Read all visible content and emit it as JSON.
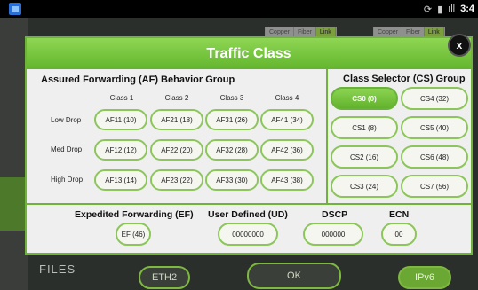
{
  "statusbar": {
    "time": "3:4"
  },
  "background": {
    "files_label": "FILES",
    "mini_tabs_left": [
      "Copper",
      "Fiber",
      "Link"
    ],
    "mini_tabs_right": [
      "Copper",
      "Fiber",
      "Link"
    ],
    "eth2_label": "ETH2",
    "ok_label": "OK",
    "ipv6_label": "IPv6"
  },
  "dialog": {
    "title": "Traffic Class",
    "close_label": "x",
    "af": {
      "title": "Assured Forwarding (AF) Behavior Group",
      "columns": [
        "Class 1",
        "Class 2",
        "Class 3",
        "Class 4"
      ],
      "rows": [
        {
          "label": "Low Drop",
          "values": [
            "AF11 (10)",
            "AF21 (18)",
            "AF31 (26)",
            "AF41 (34)"
          ]
        },
        {
          "label": "Med Drop",
          "values": [
            "AF12 (12)",
            "AF22 (20)",
            "AF32 (28)",
            "AF42 (36)"
          ]
        },
        {
          "label": "High Drop",
          "values": [
            "AF13 (14)",
            "AF23 (22)",
            "AF33 (30)",
            "AF43 (38)"
          ]
        }
      ]
    },
    "cs": {
      "title": "Class Selector (CS) Group",
      "left": [
        "CS0 (0)",
        "CS1 (8)",
        "CS2 (16)",
        "CS3 (24)"
      ],
      "right": [
        "CS4 (32)",
        "CS5 (40)",
        "CS6 (48)",
        "CS7 (56)"
      ],
      "selected": "CS0 (0)"
    },
    "ef": {
      "label": "Expedited Forwarding (EF)",
      "value": "EF (46)"
    },
    "ud": {
      "label": "User Defined (UD)",
      "value": "00000000"
    },
    "dscp": {
      "label": "DSCP",
      "value": "000000"
    },
    "ecn": {
      "label": "ECN",
      "value": "00"
    }
  },
  "colors": {
    "accent": "#6fb33a",
    "header_top": "#8ed653",
    "selected": "#62b22c"
  }
}
